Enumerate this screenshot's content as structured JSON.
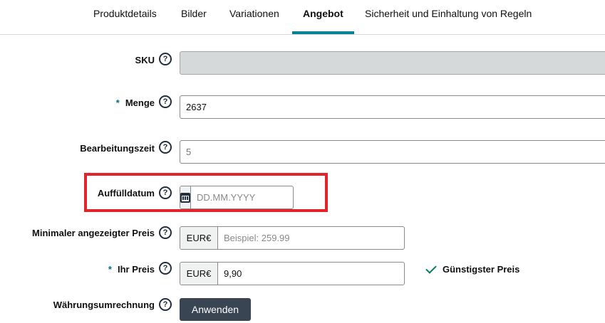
{
  "tabs": [
    {
      "label": "Produktdetails",
      "active": false
    },
    {
      "label": "Bilder",
      "active": false
    },
    {
      "label": "Variationen",
      "active": false
    },
    {
      "label": "Angebot",
      "active": true
    },
    {
      "label": "Sicherheit und Einhaltung von Regeln",
      "active": false
    }
  ],
  "help_glyph": "?",
  "required_marker": "*",
  "fields": {
    "sku": {
      "label": "SKU",
      "value": ""
    },
    "quantity": {
      "label": "Menge",
      "value": "2637"
    },
    "handling_time": {
      "label": "Bearbeitungszeit",
      "value": "5"
    },
    "restock_date": {
      "label": "Auffülldatum",
      "placeholder": "DD.MM.YYYY"
    },
    "min_price": {
      "label": "Minimaler angezeigter Preis",
      "currency": "EUR€",
      "placeholder": "Beispiel: 259.99"
    },
    "your_price": {
      "label": "Ihr Preis",
      "currency": "EUR€",
      "value": "9,90",
      "hint": "Günstigster Preis"
    },
    "currency_conversion": {
      "label": "Währungsumrechnung",
      "button_label": "Anwenden"
    }
  },
  "colors": {
    "accent": "#008296",
    "highlight": "#e3242b",
    "button": "#3a4553",
    "success": "#067d62"
  }
}
